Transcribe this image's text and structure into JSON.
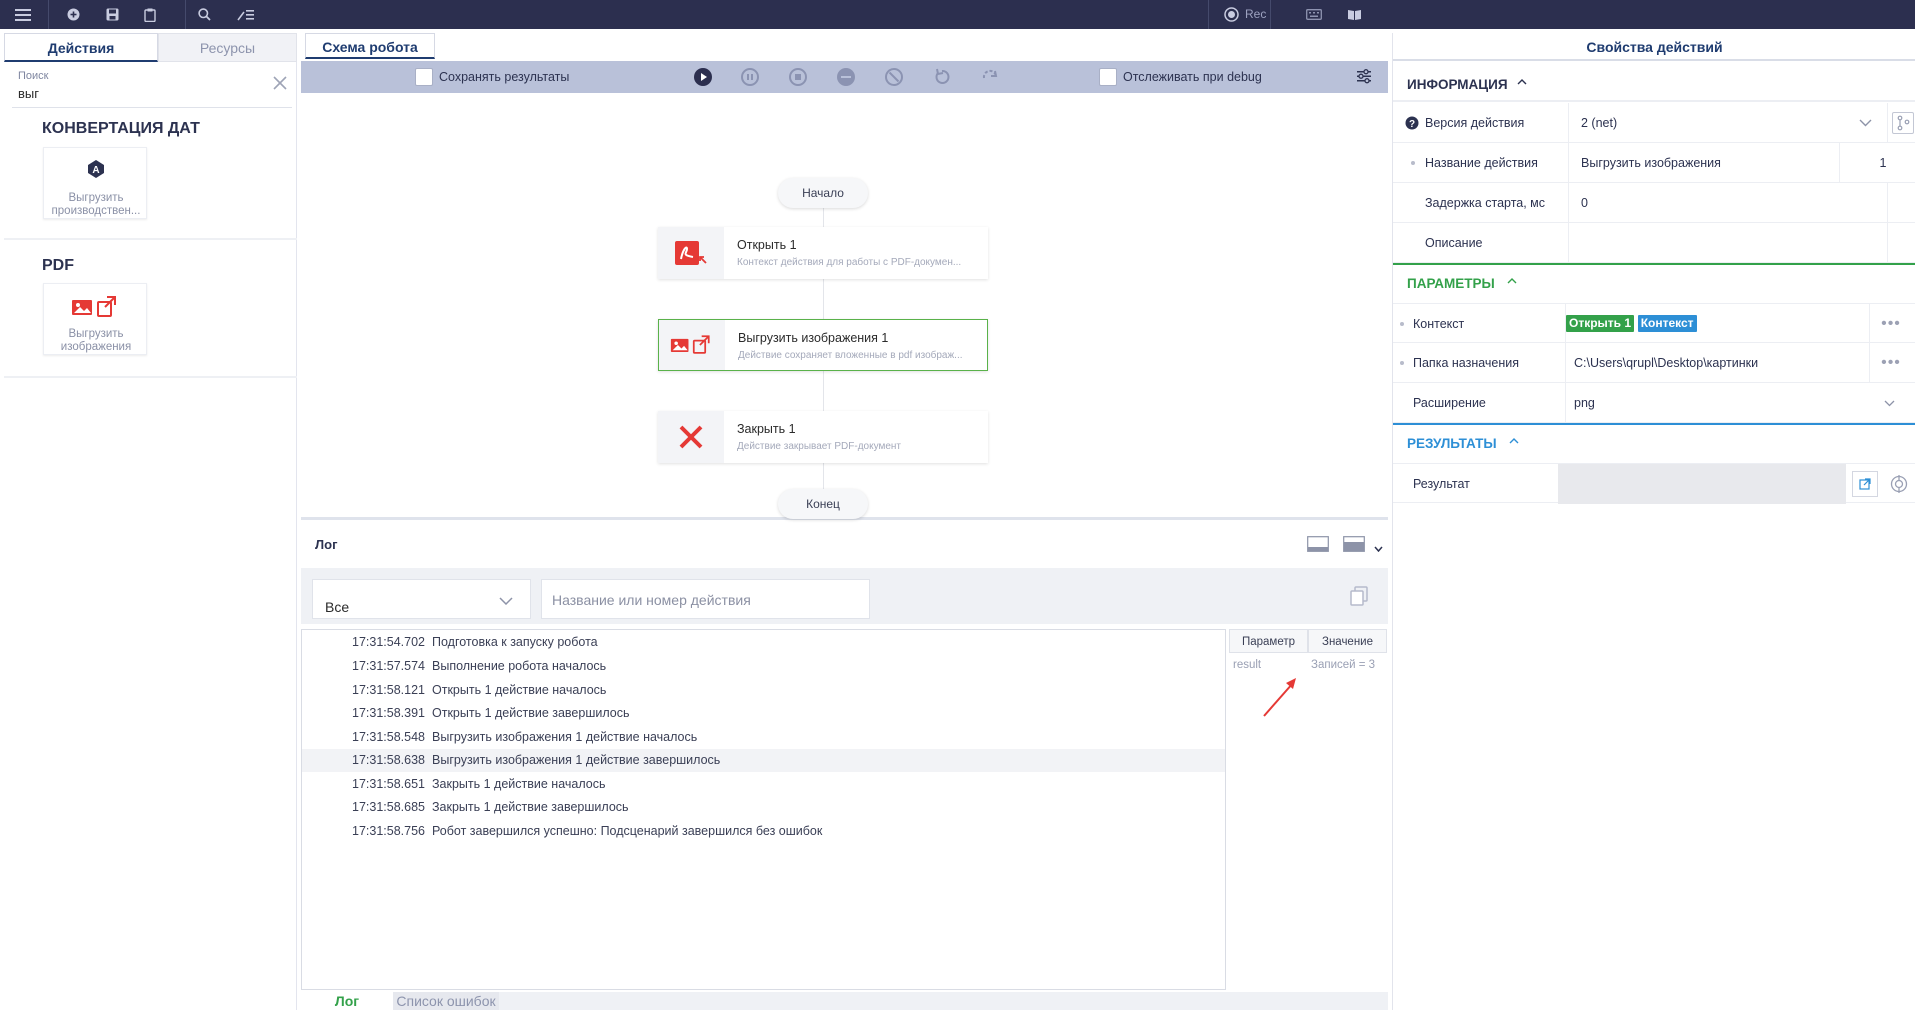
{
  "topbar": {
    "rec_label": "Rec"
  },
  "left": {
    "tab_actions": "Действия",
    "tab_resources": "Ресурсы",
    "search_label": "Поиск",
    "search_value": "выг",
    "categories": [
      {
        "title": "КОНВЕРТАЦИЯ ДАТ",
        "card_label_1": "Выгрузить",
        "card_label_2": "производствен..."
      },
      {
        "title": "PDF",
        "card_label_1": "Выгрузить",
        "card_label_2": "изображения"
      }
    ]
  },
  "center": {
    "tab_title": "Схема робота",
    "save_results_label": "Сохранять результаты",
    "track_debug_label": "Отслеживать при debug",
    "start_label": "Начало",
    "end_label": "Конец",
    "nodes": [
      {
        "title": "Открыть  1",
        "desc": "Контекст действия для работы с PDF-докумен..."
      },
      {
        "title": "Выгрузить изображения  1",
        "desc": "Действие сохраняет вложенные в pdf изображ..."
      },
      {
        "title": "Закрыть  1",
        "desc": "Действие закрывает PDF-документ"
      }
    ]
  },
  "log": {
    "title": "Лог",
    "filter_value": "Все",
    "search_placeholder": "Название или номер действия",
    "rows": [
      {
        "time": "17:31:54.702",
        "msg": "Подготовка к запуску робота"
      },
      {
        "time": "17:31:57.574",
        "msg": "Выполнение робота началось"
      },
      {
        "time": "17:31:58.121",
        "msg": "Открыть 1 действие началось"
      },
      {
        "time": "17:31:58.391",
        "msg": "Открыть 1 действие завершилось"
      },
      {
        "time": "17:31:58.548",
        "msg": "Выгрузить изображения 1 действие началось"
      },
      {
        "time": "17:31:58.638",
        "msg": "Выгрузить изображения 1 действие завершилось"
      },
      {
        "time": "17:31:58.651",
        "msg": "Закрыть 1 действие началось"
      },
      {
        "time": "17:31:58.685",
        "msg": "Закрыть 1 действие завершилось"
      },
      {
        "time": "17:31:58.756",
        "msg": "Робот завершился успешно: Подсценарий завершился без ошибок"
      }
    ],
    "param_header": "Параметр",
    "value_header": "Значение",
    "param_name": "result",
    "param_value": "Записей = 3",
    "tab_log": "Лог",
    "tab_errors": "Список ошибок"
  },
  "right": {
    "title": "Свойства действий",
    "info_title": "ИНФОРМАЦИЯ",
    "params_title": "ПАРАМЕТРЫ",
    "results_title": "РЕЗУЛЬТАТЫ",
    "version_label": "Версия действия",
    "version_value": "2 (net)",
    "name_label": "Название действия",
    "name_value": "Выгрузить изображения",
    "name_num": "1",
    "delay_label": "Задержка старта, мс",
    "delay_value": "0",
    "desc_label": "Описание",
    "context_label": "Контекст",
    "context_tag_1": "Открыть 1",
    "context_tag_2": "Контекст",
    "folder_label": "Папка назначения",
    "folder_value": "C:\\Users\\qrupl\\Desktop\\картинки",
    "ext_label": "Расширение",
    "ext_value": "png",
    "result_label": "Результат"
  },
  "colors": {
    "topbar": "#2c2f4f",
    "accent_blue": "#1f3c70",
    "green": "#33a14a",
    "blue": "#2d8fd6",
    "pdf_red": "#e53935"
  }
}
